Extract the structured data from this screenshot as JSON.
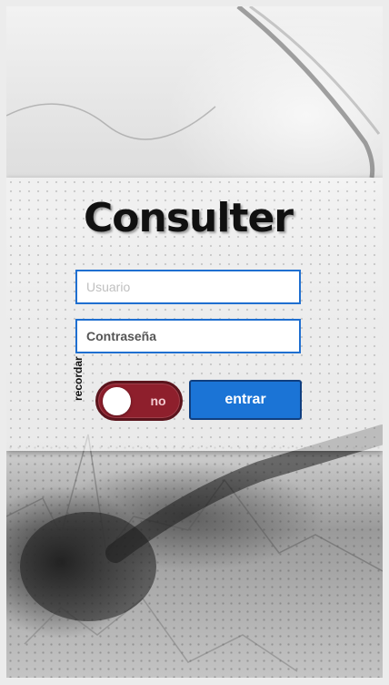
{
  "app": {
    "title": "Consulter"
  },
  "login": {
    "username_placeholder": "Usuario",
    "username_value": "",
    "password_placeholder": "Contraseña",
    "password_value": "",
    "remember_label": "recordar",
    "remember_state_label": "no",
    "remember_on": false,
    "submit_label": "entrar"
  },
  "colors": {
    "accent": "#1b74d6",
    "toggle_off": "#8e1f2c"
  }
}
